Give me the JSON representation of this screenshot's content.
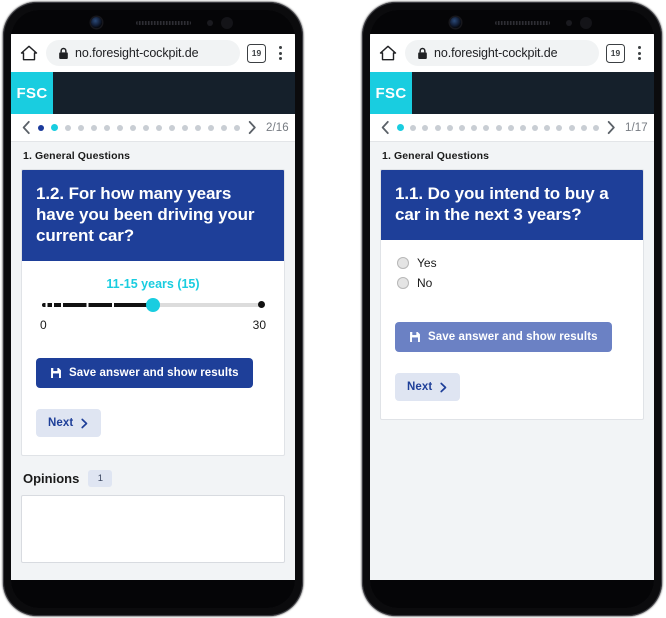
{
  "browser": {
    "home_icon": "home-icon",
    "lock_icon": "lock-icon",
    "url": "no.foresight-cockpit.de",
    "tab_count": "19",
    "menu_icon": "kebab-menu-icon"
  },
  "app": {
    "logo_text": "FSC",
    "accent_cyan": "#19cde0",
    "header_navy": "#15202b",
    "brand_blue": "#1e3f99"
  },
  "left_phone": {
    "pager": {
      "prev_icon": "chevron-left-icon",
      "next_icon": "chevron-right-icon",
      "count": "2/16",
      "total_dots": 16,
      "visited_index": 0,
      "current_index": 1
    },
    "section_title": "1. General Questions",
    "question": "1.2. For how many years have you been driving your current car?",
    "slider": {
      "value_label": "11-15 years (15)",
      "min_label": "0",
      "max_label": "30",
      "min": 0,
      "max": 30,
      "value": 15,
      "fill_percent": 50
    },
    "save_button": {
      "label": "Save answer and show results",
      "icon": "save-floppy-icon",
      "state": "enabled"
    },
    "next_button": {
      "label": "Next",
      "icon": "chevron-right-icon"
    },
    "opinions": {
      "title": "Opinions",
      "badge": "1",
      "textarea_value": "",
      "textarea_placeholder": ""
    }
  },
  "right_phone": {
    "pager": {
      "prev_icon": "chevron-left-icon",
      "next_icon": "chevron-right-icon",
      "count": "1/17",
      "total_dots": 17,
      "visited_index": -1,
      "current_index": 0
    },
    "section_title": "1. General Questions",
    "question": "1.1. Do you intend to buy a car in the next 3 years?",
    "options": [
      {
        "label": "Yes",
        "selected": false
      },
      {
        "label": "No",
        "selected": false
      }
    ],
    "save_button": {
      "label": "Save answer and show results",
      "icon": "save-floppy-icon",
      "state": "muted"
    },
    "next_button": {
      "label": "Next",
      "icon": "chevron-right-icon"
    }
  }
}
